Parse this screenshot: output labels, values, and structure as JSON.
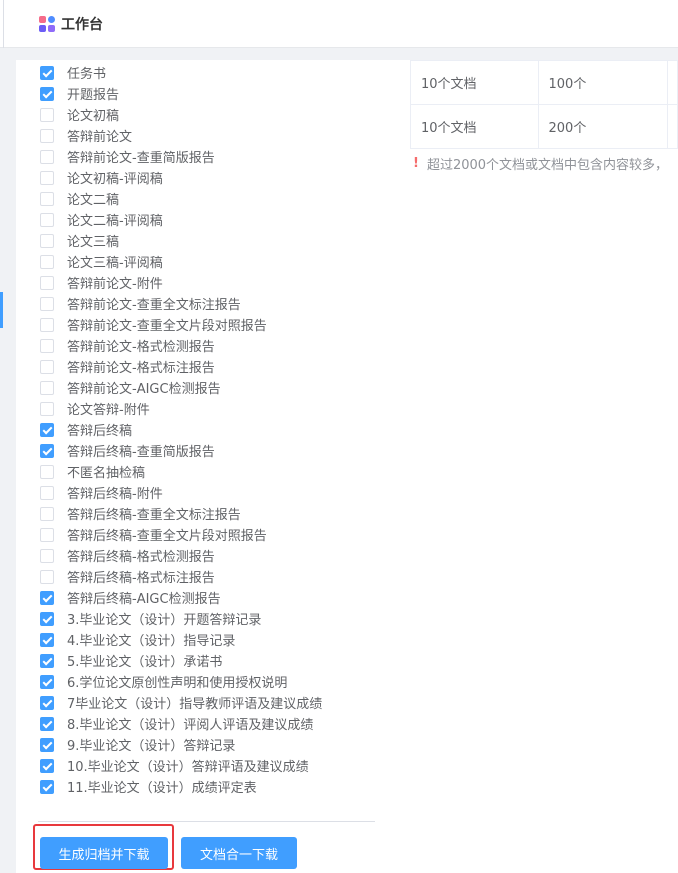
{
  "header": {
    "title": "工作台",
    "icon": "grid-app-icon"
  },
  "checklist": [
    {
      "label": "任务书",
      "checked": true
    },
    {
      "label": "开题报告",
      "checked": true
    },
    {
      "label": "论文初稿",
      "checked": false
    },
    {
      "label": "答辩前论文",
      "checked": false
    },
    {
      "label": "答辩前论文-查重简版报告",
      "checked": false
    },
    {
      "label": "论文初稿-评阅稿",
      "checked": false
    },
    {
      "label": "论文二稿",
      "checked": false
    },
    {
      "label": "论文二稿-评阅稿",
      "checked": false
    },
    {
      "label": "论文三稿",
      "checked": false
    },
    {
      "label": "论文三稿-评阅稿",
      "checked": false
    },
    {
      "label": "答辩前论文-附件",
      "checked": false
    },
    {
      "label": "答辩前论文-查重全文标注报告",
      "checked": false
    },
    {
      "label": "答辩前论文-查重全文片段对照报告",
      "checked": false
    },
    {
      "label": "答辩前论文-格式检测报告",
      "checked": false
    },
    {
      "label": "答辩前论文-格式标注报告",
      "checked": false
    },
    {
      "label": "答辩前论文-AIGC检测报告",
      "checked": false
    },
    {
      "label": "论文答辩-附件",
      "checked": false
    },
    {
      "label": "答辩后终稿",
      "checked": true
    },
    {
      "label": "答辩后终稿-查重简版报告",
      "checked": true
    },
    {
      "label": "不匿名抽检稿",
      "checked": false
    },
    {
      "label": "答辩后终稿-附件",
      "checked": false
    },
    {
      "label": "答辩后终稿-查重全文标注报告",
      "checked": false
    },
    {
      "label": "答辩后终稿-查重全文片段对照报告",
      "checked": false
    },
    {
      "label": "答辩后终稿-格式检测报告",
      "checked": false
    },
    {
      "label": "答辩后终稿-格式标注报告",
      "checked": false
    },
    {
      "label": "答辩后终稿-AIGC检测报告",
      "checked": true
    },
    {
      "label": "3.毕业论文（设计）开题答辩记录",
      "checked": true
    },
    {
      "label": "4.毕业论文（设计）指导记录",
      "checked": true
    },
    {
      "label": "5.毕业论文（设计）承诺书",
      "checked": true
    },
    {
      "label": "6.学位论文原创性声明和使用授权说明",
      "checked": true
    },
    {
      "label": "7毕业论文（设计）指导教师评语及建议成绩",
      "checked": true
    },
    {
      "label": "8.毕业论文（设计）评阅人评语及建议成绩",
      "checked": true
    },
    {
      "label": "9.毕业论文（设计）答辩记录",
      "checked": true
    },
    {
      "label": "10.毕业论文（设计）答辩评语及建议成绩",
      "checked": true
    },
    {
      "label": "11.毕业论文（设计）成绩评定表",
      "checked": true
    }
  ],
  "buttons": {
    "generate_archive": "生成归档并下载",
    "merge_download": "文档合一下载"
  },
  "table": {
    "rows": [
      {
        "docs": "10个文档",
        "count": "100个"
      },
      {
        "docs": "10个文档",
        "count": "200个"
      }
    ]
  },
  "warning": {
    "icon": "!",
    "text": "超过2000个文档或文档中包含内容较多，"
  },
  "colors": {
    "accent": "#409eff",
    "highlight": "#e8393d",
    "warning": "#f56c6c"
  }
}
